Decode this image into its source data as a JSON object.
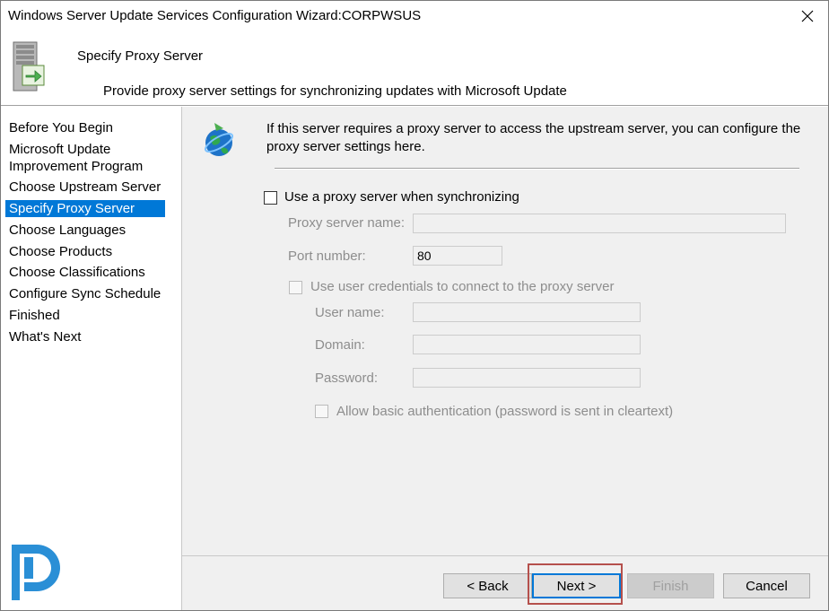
{
  "window": {
    "title": "Windows Server Update Services Configuration Wizard:CORPWSUS"
  },
  "header": {
    "heading": "Specify Proxy Server",
    "subheading": "Provide proxy server settings for synchronizing updates with Microsoft Update"
  },
  "steps": [
    {
      "label": "Before You Begin",
      "active": false
    },
    {
      "label": "Microsoft Update",
      "active": false
    },
    {
      "label": "Improvement Program",
      "active": false
    },
    {
      "label": "Choose Upstream Server",
      "active": false
    },
    {
      "label": "Specify Proxy Server",
      "active": true
    },
    {
      "label": "Choose Languages",
      "active": false
    },
    {
      "label": "Choose Products",
      "active": false
    },
    {
      "label": "Choose Classifications",
      "active": false
    },
    {
      "label": "Configure Sync Schedule",
      "active": false
    },
    {
      "label": "Finished",
      "active": false
    },
    {
      "label": "What's Next",
      "active": false
    }
  ],
  "content": {
    "description": "If this server requires a proxy server to access the upstream server, you can configure the proxy server settings here.",
    "use_proxy_label": "Use a proxy server when synchronizing",
    "use_proxy_checked": false,
    "proxy_name_label": "Proxy server name:",
    "proxy_name_value": "",
    "port_label": "Port number:",
    "port_value": "80",
    "use_credentials_label": "Use user credentials to connect to the proxy server",
    "username_label": "User name:",
    "username_value": "",
    "domain_label": "Domain:",
    "domain_value": "",
    "password_label": "Password:",
    "password_value": "",
    "basic_auth_label": "Allow basic authentication (password is sent in cleartext)"
  },
  "buttons": {
    "back": "< Back",
    "next": "Next >",
    "finish": "Finish",
    "cancel": "Cancel"
  },
  "icons": {
    "close": "close-icon",
    "server": "server-update-icon",
    "globe": "globe-icon",
    "logo": "prajwal-logo-icon"
  },
  "colors": {
    "selection": "#0078d7",
    "highlight_border": "#b5504c",
    "content_bg": "#f0f0f0"
  }
}
